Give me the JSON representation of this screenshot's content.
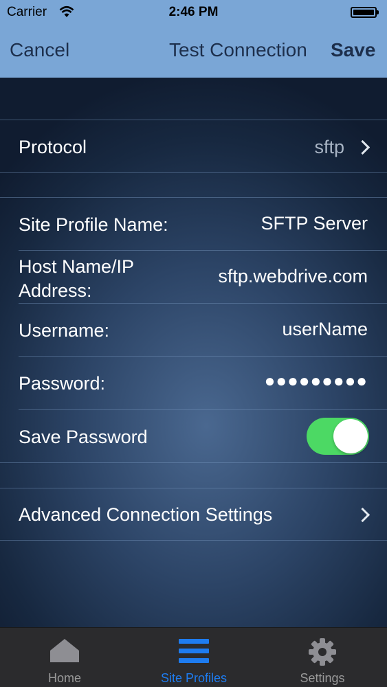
{
  "status_bar": {
    "carrier": "Carrier",
    "time": "2:46 PM"
  },
  "nav": {
    "cancel": "Cancel",
    "test_connection": "Test Connection",
    "save": "Save"
  },
  "protocol": {
    "label": "Protocol",
    "value": "sftp"
  },
  "fields": {
    "site_profile_name": {
      "label": "Site Profile Name:",
      "value": "SFTP Server"
    },
    "host_name": {
      "label_line1": "Host Name/IP",
      "label_line2": "Address:",
      "value": "sftp.webdrive.com"
    },
    "username": {
      "label": "Username:",
      "value": "userName"
    },
    "password": {
      "label": "Password:",
      "value": "●●●●●●●●●"
    },
    "save_password": {
      "label": "Save Password",
      "enabled": true
    }
  },
  "advanced": {
    "label": "Advanced Connection Settings"
  },
  "tabs": [
    {
      "label": "Home",
      "icon": "home-icon"
    },
    {
      "label": "Site Profiles",
      "icon": "list-icon",
      "active": true
    },
    {
      "label": "Settings",
      "icon": "gear-icon"
    }
  ],
  "colors": {
    "nav_bar": "#7aa6d6",
    "toggle_on": "#4cd964",
    "tab_active": "#1e7cf0"
  }
}
